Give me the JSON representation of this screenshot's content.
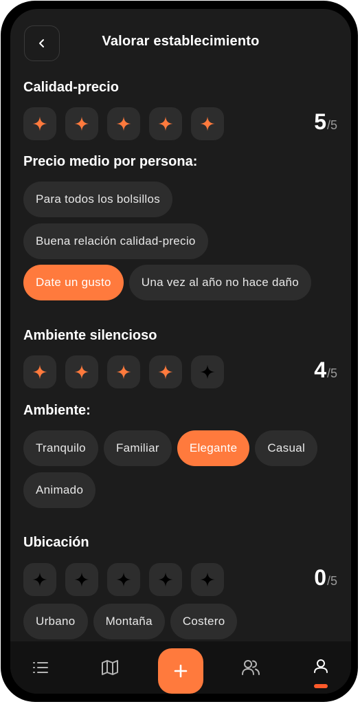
{
  "header": {
    "title": "Valorar establecimiento",
    "back_icon": "chevron-left-icon"
  },
  "colors": {
    "accent": "#ff7a3d",
    "chip": "#2d2d2d",
    "background": "#1c1c1c",
    "star_empty": "#000000"
  },
  "sections": [
    {
      "rating_title": "Calidad-precio",
      "rating": 5,
      "max": 5,
      "score_value": "5",
      "score_max": "/5",
      "chips_title": "Precio medio por persona:",
      "chips": [
        {
          "label": "Para todos los bolsillos",
          "selected": false
        },
        {
          "label": "Buena relación calidad-precio",
          "selected": false
        },
        {
          "label": "Date un gusto",
          "selected": true
        },
        {
          "label": "Una vez al año no hace daño",
          "selected": false
        }
      ]
    },
    {
      "rating_title": "Ambiente silencioso",
      "rating": 4,
      "max": 5,
      "score_value": "4",
      "score_max": "/5",
      "chips_title": "Ambiente:",
      "chips": [
        {
          "label": "Tranquilo",
          "selected": false
        },
        {
          "label": "Familiar",
          "selected": false
        },
        {
          "label": "Elegante",
          "selected": true
        },
        {
          "label": "Casual",
          "selected": false
        },
        {
          "label": "Animado",
          "selected": false
        }
      ]
    },
    {
      "rating_title": "Ubicación",
      "rating": 0,
      "max": 5,
      "score_value": "0",
      "score_max": "/5",
      "chips": [
        {
          "label": "Urbano",
          "selected": false
        },
        {
          "label": "Montaña",
          "selected": false
        },
        {
          "label": "Costero",
          "selected": false
        }
      ]
    }
  ],
  "tabbar": {
    "items": [
      {
        "icon": "list-icon"
      },
      {
        "icon": "map-icon"
      },
      {
        "icon": "plus-icon"
      },
      {
        "icon": "users-icon"
      },
      {
        "icon": "profile-icon",
        "active": true
      }
    ]
  }
}
